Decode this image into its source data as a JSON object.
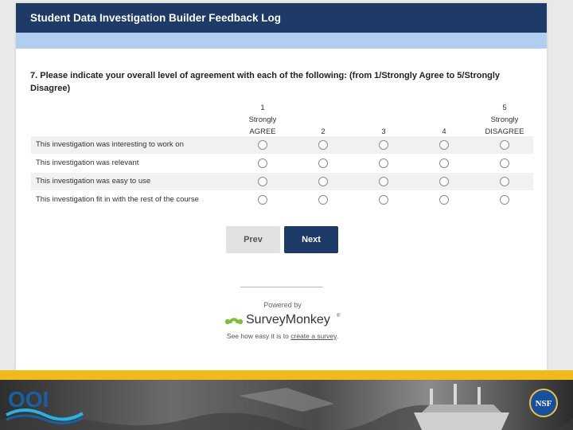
{
  "survey": {
    "title": "Student Data Investigation Builder Feedback Log",
    "question": "7. Please indicate your overall level of agreement with each of the following: (from 1/Strongly Agree to 5/Strongly Disagree)",
    "columns": [
      {
        "line1": "1",
        "line2": "Strongly",
        "line3": "AGREE"
      },
      {
        "line1": "",
        "line2": "",
        "line3": "2"
      },
      {
        "line1": "",
        "line2": "",
        "line3": "3"
      },
      {
        "line1": "",
        "line2": "",
        "line3": "4"
      },
      {
        "line1": "5",
        "line2": "Strongly",
        "line3": "DISAGREE"
      }
    ],
    "rows": [
      {
        "label": "This investigation was interesting to work on"
      },
      {
        "label": "This investigation was relevant"
      },
      {
        "label": "This investigation was easy to use"
      },
      {
        "label": "This investigation fit in with the rest of the course"
      }
    ],
    "buttons": {
      "prev": "Prev",
      "next": "Next"
    }
  },
  "footer": {
    "powered_by": "Powered by",
    "brand": "SurveyMonkey",
    "registered_mark": "®",
    "see_how": "See how easy it is to ",
    "create_link": "create a survey",
    "period": "."
  },
  "logos": {
    "ooi": "OOI",
    "nsf": "NSF"
  },
  "colors": {
    "title_bar": "#1e3a66",
    "progress_bar": "#b3cdf0",
    "next_button": "#1e3a66",
    "prev_button": "#e2e2e2",
    "gold_strip": "#f3b91b",
    "surveymonkey_green": "#80bd3b",
    "ooi_blue": "#1c5fa0"
  },
  "icons": [
    "radio-button-icon",
    "surveymonkey-logo-icon",
    "ooi-logo",
    "nsf-logo"
  ]
}
